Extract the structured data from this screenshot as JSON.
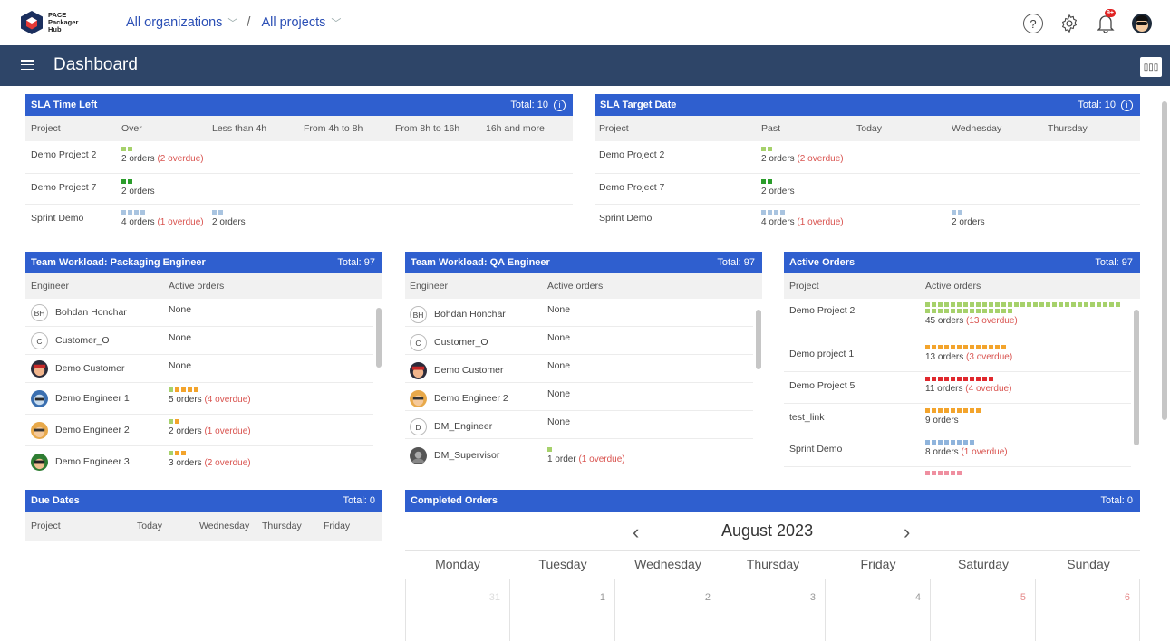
{
  "app": {
    "logo_lines": [
      "PACE",
      "Packager",
      "Hub"
    ],
    "breadcrumb_org": "All organizations",
    "breadcrumb_project": "All projects",
    "breadcrumb_sep": "/",
    "page_title": "Dashboard",
    "layout_button": "▯▯▯",
    "help_symbol": "?",
    "notification_badge": "9+"
  },
  "sla_time_left": {
    "title": "SLA Time Left",
    "total": "Total: 10",
    "columns": [
      "Project",
      "Over",
      "Less than 4h",
      "From 4h to 8h",
      "From 8h to 16h",
      "16h and more"
    ],
    "rows": [
      {
        "project": "Demo Project 2",
        "over_text": "2 orders",
        "over_overdue": "(2 overdue)",
        "more_text": ""
      },
      {
        "project": "Demo Project 7",
        "over_text": "2 orders",
        "over_overdue": "",
        "more_text": ""
      },
      {
        "project": "Sprint Demo",
        "over_text": "4 orders",
        "over_overdue": "(1 overdue)",
        "more_text": "2 orders"
      }
    ]
  },
  "sla_target_date": {
    "title": "SLA Target Date",
    "total": "Total: 10",
    "columns": [
      "Project",
      "Past",
      "Today",
      "Wednesday",
      "Thursday"
    ],
    "rows": [
      {
        "project": "Demo Project 2",
        "past_text": "2 orders",
        "past_overdue": "(2 overdue)",
        "wed_text": ""
      },
      {
        "project": "Demo Project 7",
        "past_text": "2 orders",
        "past_overdue": "",
        "wed_text": ""
      },
      {
        "project": "Sprint Demo",
        "past_text": "4 orders",
        "past_overdue": "(1 overdue)",
        "wed_text": "2 orders"
      }
    ]
  },
  "workload_packaging": {
    "title": "Team Workload: Packaging Engineer",
    "total": "Total: 97",
    "columns": [
      "Engineer",
      "Active orders"
    ],
    "rows": [
      {
        "initials": "BH",
        "name": "Bohdan Honchar",
        "text": "None",
        "overdue": ""
      },
      {
        "initials": "C",
        "name": "Customer_O",
        "text": "None",
        "overdue": ""
      },
      {
        "initials": "",
        "name": "Demo Customer",
        "text": "None",
        "overdue": ""
      },
      {
        "initials": "",
        "name": "Demo Engineer 1",
        "text": "5 orders",
        "overdue": "(4 overdue)"
      },
      {
        "initials": "",
        "name": "Demo Engineer 2",
        "text": "2 orders",
        "overdue": "(1 overdue)"
      },
      {
        "initials": "",
        "name": "Demo Engineer 3",
        "text": "3 orders",
        "overdue": "(2 overdue)"
      }
    ]
  },
  "workload_qa": {
    "title": "Team Workload: QA Engineer",
    "total": "Total: 97",
    "columns": [
      "Engineer",
      "Active orders"
    ],
    "rows": [
      {
        "initials": "BH",
        "name": "Bohdan Honchar",
        "text": "None",
        "overdue": ""
      },
      {
        "initials": "C",
        "name": "Customer_O",
        "text": "None",
        "overdue": ""
      },
      {
        "initials": "",
        "name": "Demo Customer",
        "text": "None",
        "overdue": ""
      },
      {
        "initials": "",
        "name": "Demo Engineer 2",
        "text": "None",
        "overdue": ""
      },
      {
        "initials": "D",
        "name": "DM_Engineer",
        "text": "None",
        "overdue": ""
      },
      {
        "initials": "",
        "name": "DM_Supervisor",
        "text": "1 order",
        "overdue": "(1 overdue)"
      }
    ]
  },
  "active_orders": {
    "title": "Active Orders",
    "total": "Total: 97",
    "columns": [
      "Project",
      "Active orders"
    ],
    "rows": [
      {
        "project": "Demo Project 2",
        "text": "45 orders",
        "overdue": "(13 overdue)"
      },
      {
        "project": "Demo project 1",
        "text": "13 orders",
        "overdue": "(3 overdue)"
      },
      {
        "project": "Demo Project 5",
        "text": "11 orders",
        "overdue": "(4 overdue)"
      },
      {
        "project": "test_link",
        "text": "9 orders",
        "overdue": ""
      },
      {
        "project": "Sprint Demo",
        "text": "8 orders",
        "overdue": "(1 overdue)"
      }
    ]
  },
  "due_dates": {
    "title": "Due Dates",
    "total": "Total: 0",
    "columns": [
      "Project",
      "Today",
      "Wednesday",
      "Thursday",
      "Friday"
    ]
  },
  "completed_orders": {
    "title": "Completed Orders",
    "total": "Total: 0",
    "month": "August 2023",
    "prev": "‹",
    "next": "›",
    "weekdays": [
      "Monday",
      "Tuesday",
      "Wednesday",
      "Thursday",
      "Friday",
      "Saturday",
      "Sunday"
    ],
    "days": [
      "31",
      "1",
      "2",
      "3",
      "4",
      "5",
      "6"
    ]
  },
  "colors": {
    "header_blue": "#2f5fcf",
    "nav_dark": "#2e4568",
    "overdue_red": "#d9534f"
  }
}
